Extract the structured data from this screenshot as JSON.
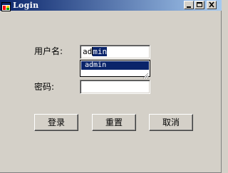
{
  "window": {
    "title": "Login",
    "icon": "app-window-icon",
    "controls": {
      "minimize": "minimize-icon",
      "maximize": "maximize-icon",
      "close": "close-icon"
    }
  },
  "form": {
    "username_label": "用户名:",
    "username_prefix": "ad",
    "username_selected": "min",
    "password_label": "密码:",
    "password_value": ""
  },
  "autocomplete": {
    "items": [
      "admin"
    ]
  },
  "buttons": {
    "login": "登录",
    "reset": "重置",
    "cancel": "取消"
  },
  "colors": {
    "titlebar_start": "#0a246a",
    "titlebar_end": "#a6caf0",
    "selection": "#0a246a",
    "face": "#d4d0c8"
  }
}
